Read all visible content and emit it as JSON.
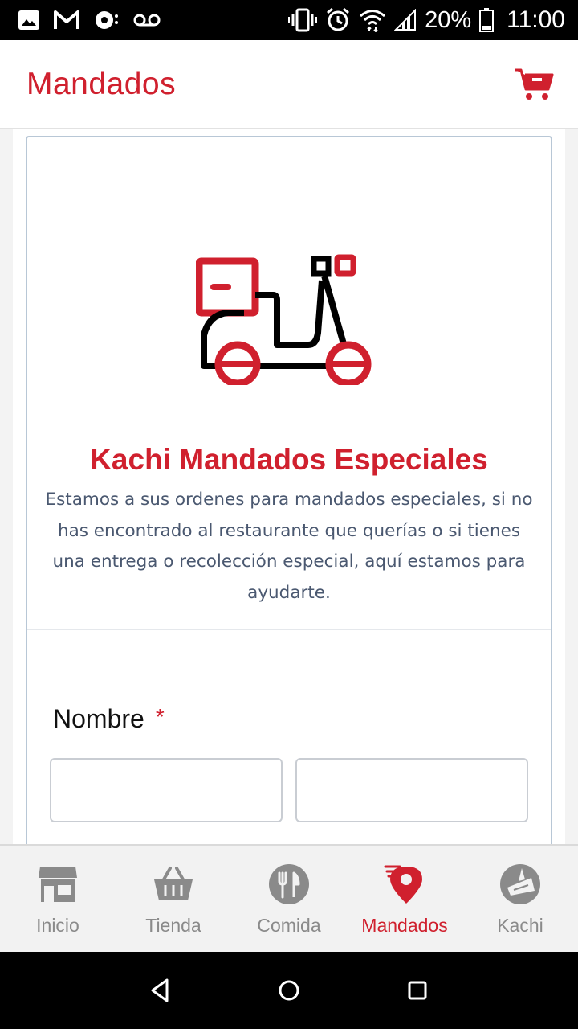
{
  "status_bar": {
    "battery": "20%",
    "time": "11:00",
    "left_icons": [
      "image-icon",
      "gmail-icon",
      "sync-icon",
      "voicemail-icon"
    ],
    "right_icons": [
      "vibrate-icon",
      "alarm-icon",
      "wifi-icon",
      "signal-icon",
      "battery-icon"
    ]
  },
  "header": {
    "title": "Mandados",
    "cart_icon": "cart-icon",
    "accent_color": "#d0202e"
  },
  "hero": {
    "illustration": "scooter-icon",
    "title": "Kachi Mandados Especiales",
    "description": "Estamos a sus ordenes para mandados especiales, si no has encontrado al restaurante que querías o si tienes una entrega o recolección especial, aquí estamos para ayudarte."
  },
  "form": {
    "name_label": "Nombre",
    "required_mark": "*",
    "first_name_value": "",
    "last_name_value": ""
  },
  "bottom_nav": {
    "items": [
      {
        "label": "Inicio",
        "icon": "store-icon",
        "active": false
      },
      {
        "label": "Tienda",
        "icon": "basket-icon",
        "active": false
      },
      {
        "label": "Comida",
        "icon": "cutlery-icon",
        "active": false
      },
      {
        "label": "Mandados",
        "icon": "delivery-pin-icon",
        "active": true
      },
      {
        "label": "Kachi",
        "icon": "kachi-icon",
        "active": false
      }
    ]
  },
  "system_nav": [
    "back-icon",
    "home-icon",
    "recents-icon"
  ]
}
